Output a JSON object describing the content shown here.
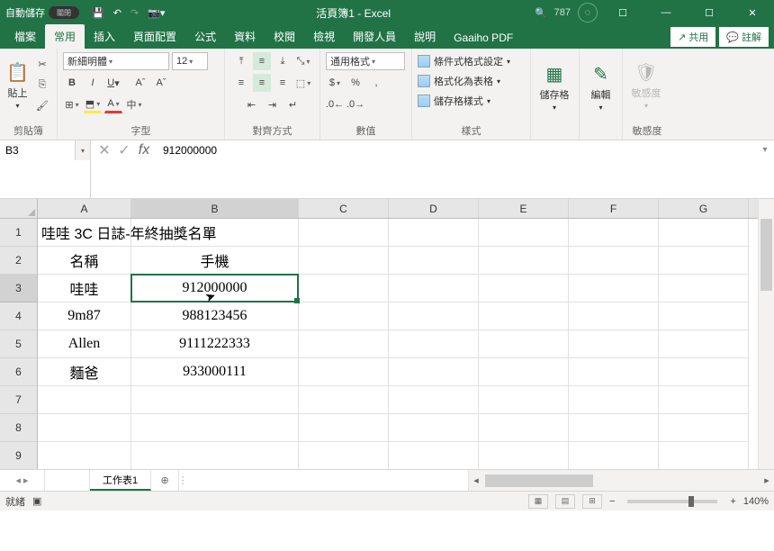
{
  "titlebar": {
    "autosave_label": "自動儲存",
    "autosave_toggle": "關閉",
    "doc_name": "活頁簿1 - Excel",
    "user_short": "787"
  },
  "tabs": {
    "file": "檔案",
    "home": "常用",
    "insert": "插入",
    "layout": "頁面配置",
    "formulas": "公式",
    "data": "資料",
    "review": "校閱",
    "view": "檢視",
    "developer": "開發人員",
    "help": "說明",
    "gaaiho": "Gaaiho PDF",
    "share": "共用",
    "comments": "註解"
  },
  "ribbon": {
    "clipboard": {
      "paste": "貼上",
      "label": "剪貼簿"
    },
    "font": {
      "name": "新細明體",
      "size": "12",
      "label": "字型"
    },
    "align": {
      "label": "對齊方式"
    },
    "number": {
      "format": "通用格式",
      "label": "數值"
    },
    "styles": {
      "conditional": "條件式格式設定",
      "as_table": "格式化為表格",
      "cell_styles": "儲存格樣式",
      "label": "樣式"
    },
    "cells": {
      "btn": "儲存格",
      "label": ""
    },
    "editing": {
      "btn": "編輯",
      "label": ""
    },
    "sensitivity": {
      "btn": "敏感度",
      "label": "敏感度"
    }
  },
  "formula_bar": {
    "cell_ref": "B3",
    "value": "912000000"
  },
  "columns": [
    "A",
    "B",
    "C",
    "D",
    "E",
    "F",
    "G"
  ],
  "rows": [
    "1",
    "2",
    "3",
    "4",
    "5",
    "6",
    "7",
    "8",
    "9"
  ],
  "selected_row": "3",
  "selected_col": "B",
  "cells": {
    "A1": "哇哇 3C 日誌-年終抽獎名單",
    "A2": "名稱",
    "B2": "手機",
    "A3": "哇哇",
    "B3": "912000000",
    "A4": "9m87",
    "B4": "988123456",
    "A5": "Allen",
    "B5": "9111222333",
    "A6": "麵爸",
    "B6": "933000111"
  },
  "sheet": {
    "name": "工作表1"
  },
  "status": {
    "ready": "就緒",
    "zoom": "140%"
  }
}
